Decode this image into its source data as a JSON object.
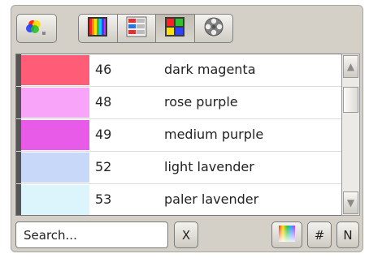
{
  "toolbar": {
    "icons": [
      "color-wheel-icon",
      "color-bars-icon",
      "color-list-icon",
      "color-grid-icon",
      "palette-icon"
    ]
  },
  "colors": [
    {
      "number": "46",
      "name": "dark magenta",
      "swatch": "#ff5c78"
    },
    {
      "number": "48",
      "name": "rose purple",
      "swatch": "#f8a4f8"
    },
    {
      "number": "49",
      "name": "medium purple",
      "swatch": "#e85ae8"
    },
    {
      "number": "52",
      "name": "light lavender",
      "swatch": "#c8d8f8"
    },
    {
      "number": "53",
      "name": "paler lavender",
      "swatch": "#dcf4fc"
    }
  ],
  "search": {
    "placeholder": "Search..."
  },
  "buttons": {
    "clear_label": "X",
    "hash_label": "#",
    "n_label": "N"
  },
  "scrollbar": {
    "up_arrow": "▲",
    "down_arrow": "▼"
  }
}
